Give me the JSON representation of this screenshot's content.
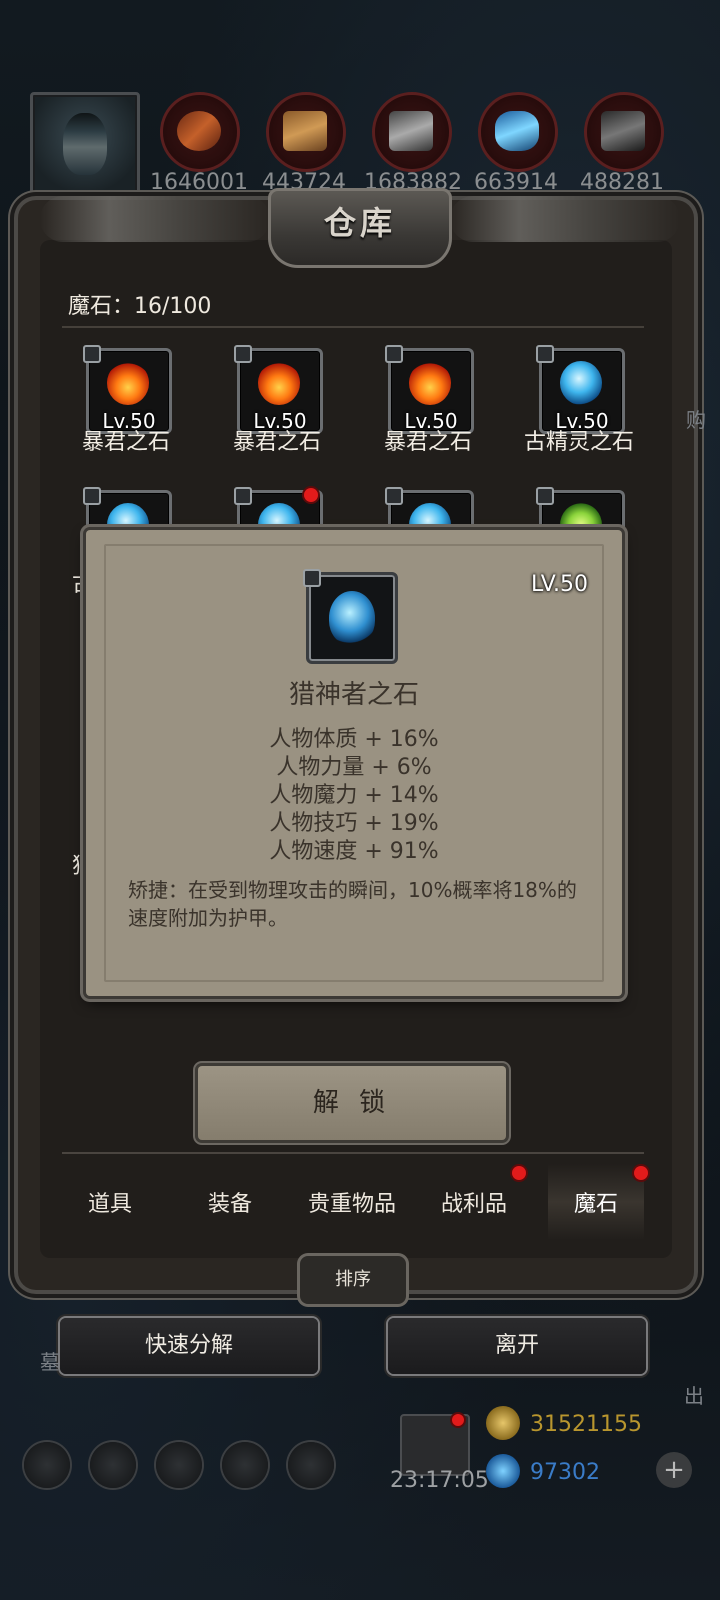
{
  "resources": {
    "counts": [
      "1646001",
      "443724",
      "1683882",
      "663914",
      "488281"
    ]
  },
  "warehouse": {
    "title": "仓库",
    "capacity_label": "魔石：16/100"
  },
  "grid": {
    "items": [
      {
        "lv": "Lv.50",
        "name": "暴君之石",
        "type": "fire"
      },
      {
        "lv": "Lv.50",
        "name": "暴君之石",
        "type": "fire"
      },
      {
        "lv": "Lv.50",
        "name": "暴君之石",
        "type": "fire"
      },
      {
        "lv": "Lv.50",
        "name": "古精灵之石",
        "type": "ice"
      }
    ],
    "partial_left_1": "古",
    "partial_left_2": "猎"
  },
  "popup": {
    "lv": "LV.50",
    "name": "猎神者之石",
    "stats": [
      "人物体质 + 16%",
      "人物力量 + 6%",
      "人物魔力 + 14%",
      "人物技巧 + 19%",
      "人物速度 + 91%"
    ],
    "description": "矫捷：在受到物理攻击的瞬间，10%概率将18%的速度附加为护甲。"
  },
  "actions": {
    "unlock": "解 锁",
    "sort": "排序",
    "quick_decompose": "快速分解",
    "leave": "离开"
  },
  "tabs": [
    "道具",
    "装备",
    "贵重物品",
    "战利品",
    "魔石"
  ],
  "footer": {
    "time": "23:17:05",
    "gold": "31521155",
    "gems": "97302"
  },
  "side_glyphs": {
    "right_top": "购",
    "right_bottom": "出",
    "left_bottom": "墓"
  },
  "colors": {
    "red_dot": "#e21b1b",
    "gold_text": "#b9962e",
    "gem_text": "#3a7cc8"
  }
}
